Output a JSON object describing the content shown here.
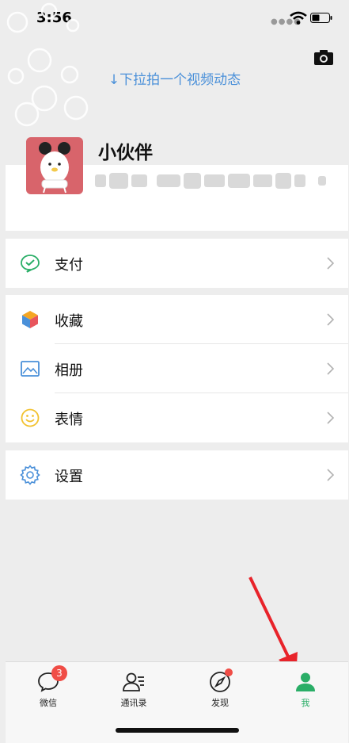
{
  "status": {
    "time": "3:56"
  },
  "header": {
    "pull_hint": "↓下拉拍一个视频动态"
  },
  "profile": {
    "name": "小伙伴"
  },
  "menu": {
    "pay": "支付",
    "favorites": "收藏",
    "album": "相册",
    "stickers": "表情",
    "settings": "设置"
  },
  "tabs": [
    {
      "label": "微信",
      "badge": "3"
    },
    {
      "label": "通讯录"
    },
    {
      "label": "发现"
    },
    {
      "label": "我"
    }
  ],
  "colors": {
    "accent_green": "#2aae67",
    "link_blue": "#4a90d9",
    "badge_red": "#f04d46"
  }
}
